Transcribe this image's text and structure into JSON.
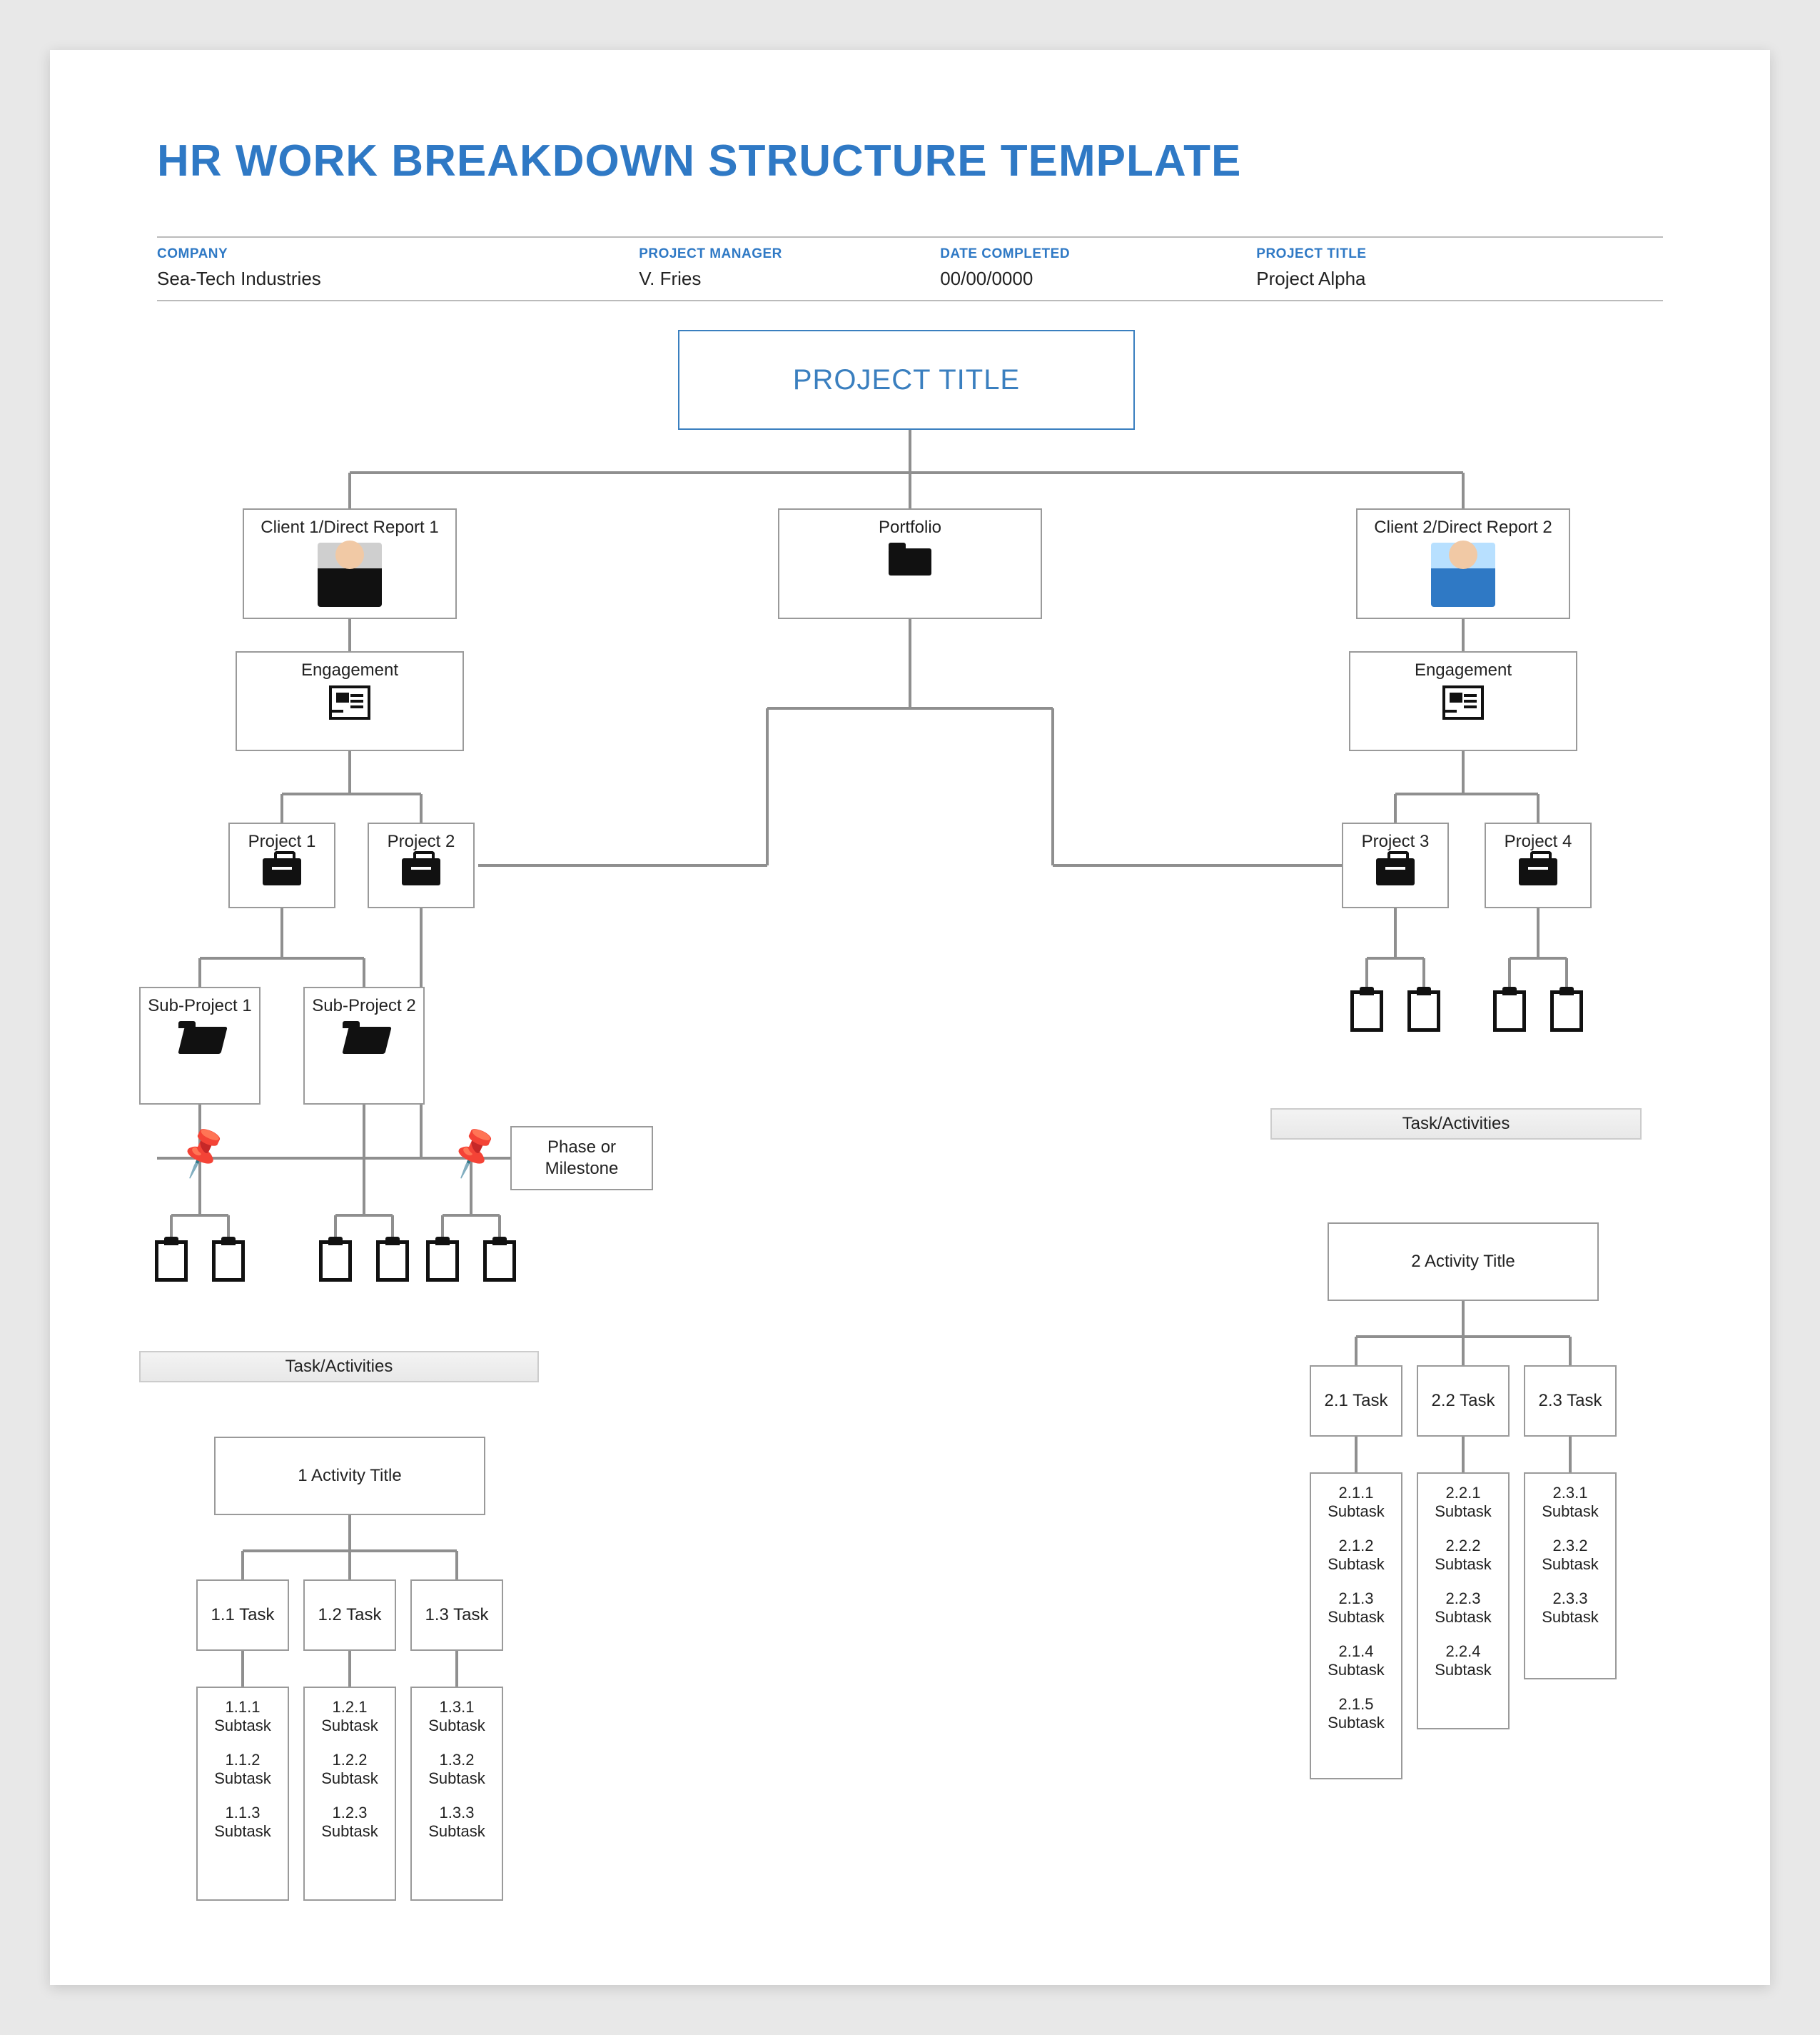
{
  "title": "HR WORK BREAKDOWN STRUCTURE TEMPLATE",
  "meta": {
    "company_label": "COMPANY",
    "company": "Sea-Tech Industries",
    "pm_label": "PROJECT MANAGER",
    "pm": "V. Fries",
    "date_label": "DATE COMPLETED",
    "date": "00/00/0000",
    "project_title_label": "PROJECT TITLE",
    "project_title": "Project Alpha"
  },
  "nodes": {
    "root": "PROJECT TITLE",
    "client1": "Client 1/Direct Report 1",
    "portfolio": "Portfolio",
    "client2": "Client 2/Direct Report 2",
    "engagement": "Engagement",
    "project1": "Project 1",
    "project2": "Project 2",
    "project3": "Project 3",
    "project4": "Project 4",
    "sub1": "Sub-Project 1",
    "sub2": "Sub-Project 2",
    "phase": "Phase or Milestone",
    "task_activities": "Task/Activities"
  },
  "activity1": {
    "title": "1 Activity Title",
    "tasks": [
      "1.1 Task",
      "1.2 Task",
      "1.3 Task"
    ],
    "subtasks": [
      [
        "1.1.1 Subtask",
        "1.1.2 Subtask",
        "1.1.3 Subtask"
      ],
      [
        "1.2.1 Subtask",
        "1.2.2 Subtask",
        "1.2.3 Subtask"
      ],
      [
        "1.3.1 Subtask",
        "1.3.2 Subtask",
        "1.3.3 Subtask"
      ]
    ]
  },
  "activity2": {
    "title": "2 Activity Title",
    "tasks": [
      "2.1 Task",
      "2.2 Task",
      "2.3 Task"
    ],
    "subtasks": [
      [
        "2.1.1 Subtask",
        "2.1.2 Subtask",
        "2.1.3 Subtask",
        "2.1.4 Subtask",
        "2.1.5 Subtask"
      ],
      [
        "2.2.1 Subtask",
        "2.2.2 Subtask",
        "2.2.3 Subtask",
        "2.2.4 Subtask"
      ],
      [
        "2.3.1 Subtask",
        "2.3.2 Subtask",
        "2.3.3 Subtask"
      ]
    ]
  }
}
